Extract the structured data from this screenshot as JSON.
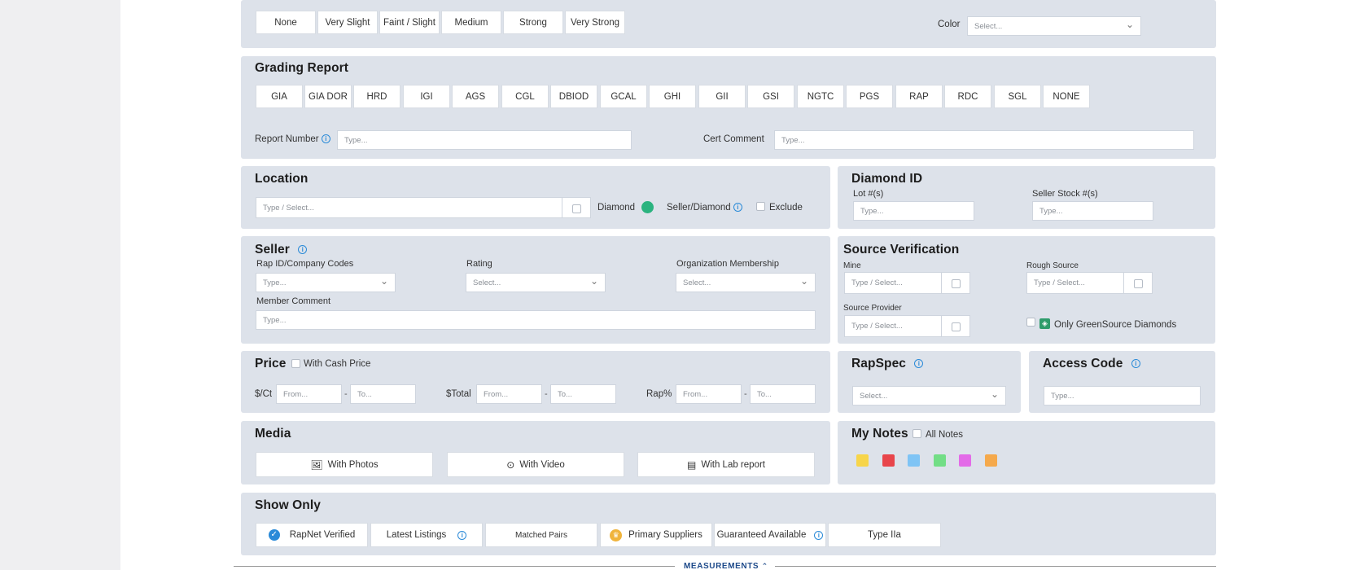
{
  "fluorescence": {
    "buttons": [
      "None",
      "Very Slight",
      "Faint / Slight",
      "Medium",
      "Strong",
      "Very Strong"
    ],
    "color_label": "Color",
    "color_placeholder": "Select..."
  },
  "grading": {
    "title": "Grading Report",
    "labs": [
      "GIA",
      "GIA DOR",
      "HRD",
      "IGI",
      "AGS",
      "CGL",
      "DBIOD",
      "GCAL",
      "GHI",
      "GII",
      "GSI",
      "NGTC",
      "PGS",
      "RAP",
      "RDC",
      "SGL",
      "NONE"
    ],
    "report_number_label": "Report Number",
    "report_number_placeholder": "Type...",
    "cert_comment_label": "Cert Comment",
    "cert_comment_placeholder": "Type..."
  },
  "location": {
    "title": "Location",
    "placeholder": "Type / Select...",
    "diamond_label": "Diamond",
    "seller_diamond_label": "Seller/Diamond",
    "exclude_label": "Exclude"
  },
  "diamond_id": {
    "title": "Diamond ID",
    "lot_label": "Lot #(s)",
    "lot_placeholder": "Type...",
    "stock_label": "Seller Stock #(s)",
    "stock_placeholder": "Type..."
  },
  "seller": {
    "title": "Seller",
    "rap_label": "Rap ID/Company Codes",
    "rap_placeholder": "Type...",
    "rating_label": "Rating",
    "rating_placeholder": "Select...",
    "org_label": "Organization Membership",
    "org_placeholder": "Select...",
    "member_comment_label": "Member Comment",
    "member_comment_placeholder": "Type..."
  },
  "source": {
    "title": "Source Verification",
    "mine_label": "Mine",
    "mine_placeholder": "Type / Select...",
    "rough_label": "Rough Source",
    "rough_placeholder": "Type / Select...",
    "provider_label": "Source Provider",
    "provider_placeholder": "Type / Select...",
    "greensource_label": "Only GreenSource Diamonds"
  },
  "price": {
    "title": "Price",
    "cash_label": "With Cash Price",
    "per_ct_label": "$/Ct",
    "total_label": "$Total",
    "rap_label": "Rap%",
    "from_placeholder": "From...",
    "to_placeholder": "To...",
    "dash": "-"
  },
  "rapspec": {
    "title": "RapSpec",
    "placeholder": "Select..."
  },
  "access_code": {
    "title": "Access Code",
    "placeholder": "Type..."
  },
  "media": {
    "title": "Media",
    "photos_label": "With Photos",
    "video_label": "With Video",
    "lab_label": "With Lab report"
  },
  "notes": {
    "title": "My Notes",
    "all_label": "All Notes",
    "colors": [
      "#f7d54a",
      "#e8454b",
      "#7fc4f5",
      "#72de86",
      "#e36be8",
      "#f5a94c"
    ]
  },
  "show_only": {
    "title": "Show Only",
    "rapnet_label": "RapNet Verified",
    "latest_label": "Latest Listings",
    "matched_label": "Matched Pairs",
    "primary_label": "Primary Suppliers",
    "guaranteed_label": "Guaranteed Available",
    "type2a_label": "Type IIa"
  },
  "measurements_label": "MEASUREMENTS",
  "colors": {
    "panel": "#dde2ea",
    "accent": "#2a8ad8",
    "toggle": "#2bb37f"
  }
}
